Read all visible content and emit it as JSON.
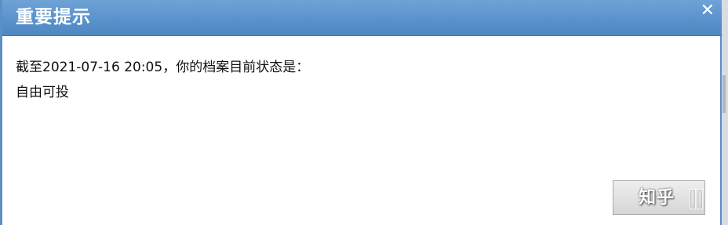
{
  "dialog": {
    "title": "重要提示",
    "close_glyph": "✕",
    "message_line1": "截至2021-07-16 20:05，你的档案目前状态是：",
    "message_line2": "自由可投"
  },
  "watermark": {
    "text": "知乎"
  },
  "icons": {
    "close": "close-icon"
  },
  "colors": {
    "titlebar": "#5a92cc",
    "border": "#5b8fc7",
    "button_bg": "#dddddd"
  }
}
